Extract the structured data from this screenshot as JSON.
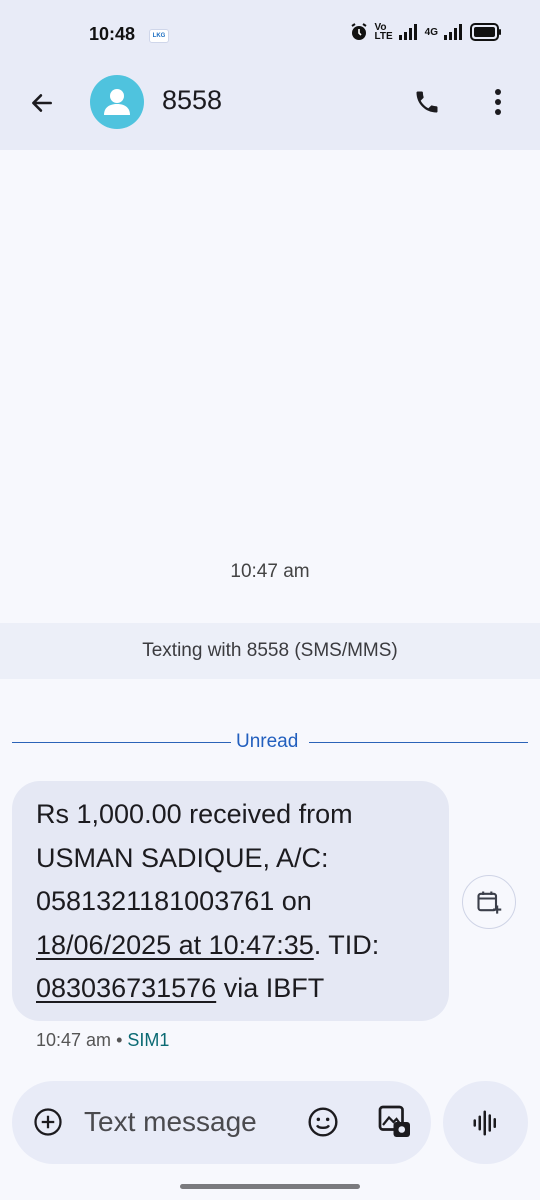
{
  "status_bar": {
    "time": "10:48",
    "badge": "LKG",
    "volte_top": "Vo",
    "volte_bottom": "LTE",
    "network": "4G"
  },
  "header": {
    "contact_name": "8558",
    "icons": [
      "back-arrow-icon",
      "person-icon",
      "phone-icon",
      "more-vert-icon"
    ]
  },
  "conversation": {
    "timestamp": "10:47 am",
    "texting_with": "Texting with 8558 (SMS/MMS)",
    "unread_label": "Unread",
    "message": {
      "line1": "Rs 1,000.00 received from",
      "line2": "USMAN SADIQUE, A/C:",
      "line3": "0581321181003761 on",
      "date_link": "18/06/2025 at 10:47:35",
      "after_date": ". TID:",
      "tid_link": "083036731576",
      "after_tid": " via IBFT"
    },
    "meta_time": "10:47 am",
    "meta_sep": "•",
    "meta_sim": "SIM1"
  },
  "compose": {
    "placeholder": "Text message"
  },
  "colors": {
    "accent": "#225fbe",
    "avatar": "#4fc3de",
    "bar_bg": "#e8ebf7",
    "bubble_bg": "#e5e8f4"
  }
}
